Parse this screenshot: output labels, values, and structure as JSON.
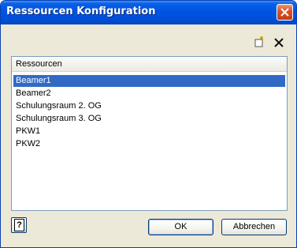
{
  "window": {
    "title": "Ressourcen Konfiguration"
  },
  "toolbar": {
    "new_icon": "new-item-icon",
    "delete_icon": "delete-icon"
  },
  "list": {
    "header": "Ressourcen",
    "items": [
      {
        "label": "Beamer1",
        "selected": true
      },
      {
        "label": "Beamer2",
        "selected": false
      },
      {
        "label": "Schulungsraum 2. OG",
        "selected": false
      },
      {
        "label": "Schulungsraum 3. OG",
        "selected": false
      },
      {
        "label": "PKW1",
        "selected": false
      },
      {
        "label": "PKW2",
        "selected": false
      }
    ]
  },
  "buttons": {
    "help_label": "?",
    "ok_label": "OK",
    "cancel_label": "Abbrechen"
  },
  "colors": {
    "titlebar": "#0054e3",
    "selection": "#316ac5",
    "close": "#d9542d",
    "dialog_bg": "#ece9d8"
  }
}
